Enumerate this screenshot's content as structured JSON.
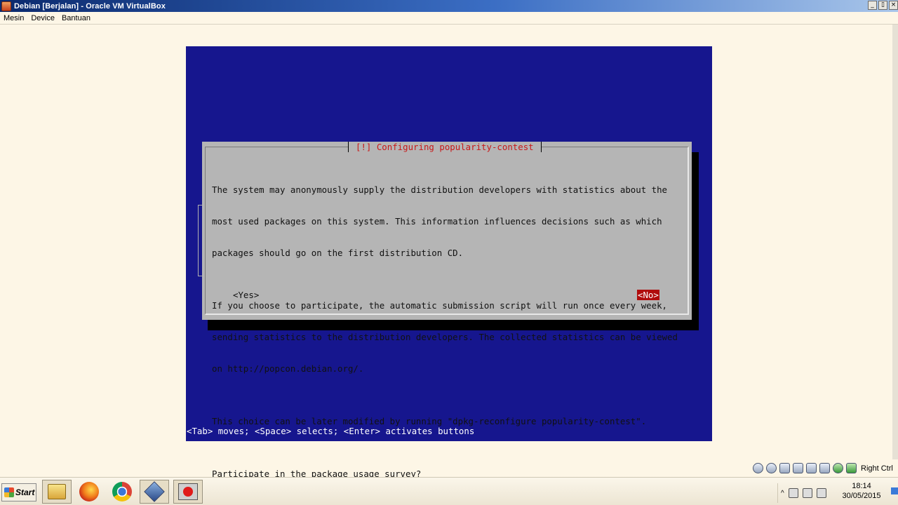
{
  "window": {
    "title": "Debian [Berjalan] - Oracle VM VirtualBox",
    "controls": {
      "minimize": "_",
      "restore": "▯",
      "close": "×"
    }
  },
  "menu": [
    "Mesin",
    "Device",
    "Bantuan"
  ],
  "vm": {
    "dialog_title": "[!] Configuring popularity-contest",
    "body_lines": [
      "The system may anonymously supply the distribution developers with statistics about the",
      "most used packages on this system. This information influences decisions such as which",
      "packages should go on the first distribution CD.",
      "",
      "If you choose to participate, the automatic submission script will run once every week,",
      "sending statistics to the distribution developers. The collected statistics can be viewed",
      "on http://popcon.debian.org/.",
      "",
      "This choice can be later modified by running \"dpkg-reconfigure popularity-contest\".",
      "",
      "Participate in the package usage survey?"
    ],
    "yes_label": "<Yes>",
    "no_label": "<No>",
    "status_line": "<Tab> moves; <Space> selects; <Enter> activates buttons"
  },
  "vbox_status": {
    "host_key": "Right Ctrl"
  },
  "taskbar": {
    "start_label": "Start",
    "apps": [
      "folder-icon",
      "firefox-icon",
      "chrome-icon",
      "virtualbox-icon",
      "screen-recorder-icon"
    ],
    "tray_chevron": "^",
    "time": "18:14",
    "date": "30/05/2015"
  },
  "colors": {
    "vm_background": "#16168e",
    "dialog_background": "#b5b5b5",
    "dialog_title": "#c81818",
    "selected_button": "#b00c0c"
  }
}
